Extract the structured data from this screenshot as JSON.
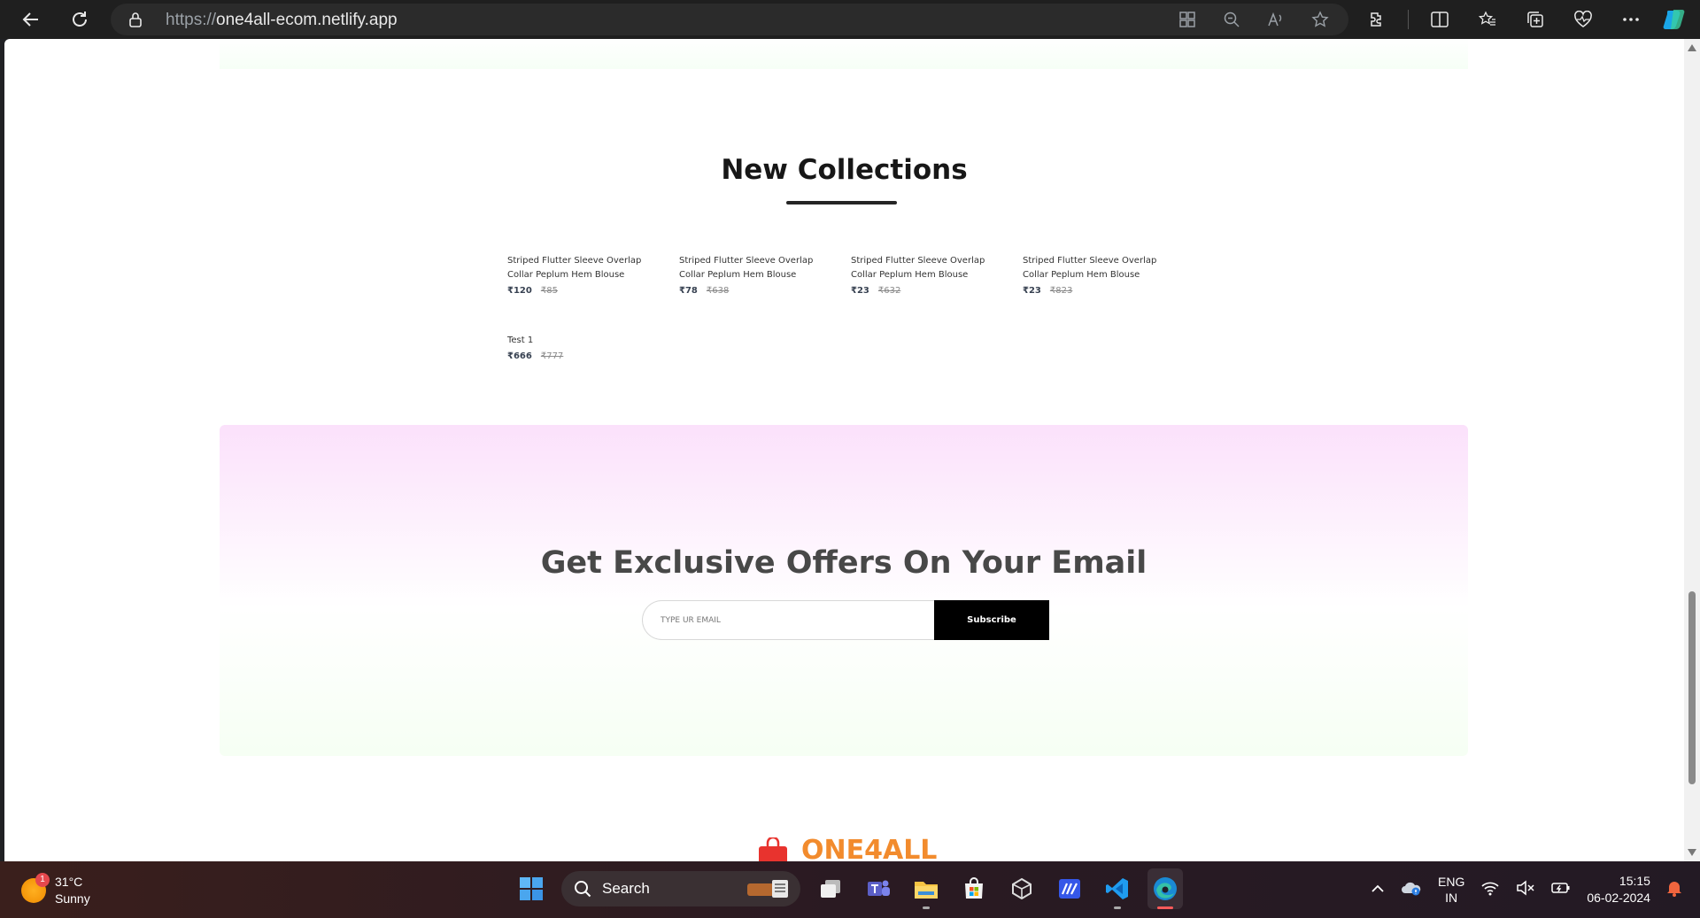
{
  "browser": {
    "url_prefix": "https://",
    "url_host": "one4all-ecom.netlify.app"
  },
  "section": {
    "title": "New Collections"
  },
  "products": [
    {
      "name": "Striped Flutter Sleeve Overlap Collar Peplum Hem Blouse",
      "new_price": "₹120",
      "old_price": "₹85"
    },
    {
      "name": "Striped Flutter Sleeve Overlap Collar Peplum Hem Blouse",
      "new_price": "₹78",
      "old_price": "₹638"
    },
    {
      "name": "Striped Flutter Sleeve Overlap Collar Peplum Hem Blouse",
      "new_price": "₹23",
      "old_price": "₹632"
    },
    {
      "name": "Striped Flutter Sleeve Overlap Collar Peplum Hem Blouse",
      "new_price": "₹23",
      "old_price": "₹823"
    },
    {
      "name": "Test 1",
      "new_price": "₹666",
      "old_price": "₹777"
    }
  ],
  "offers": {
    "title": "Get Exclusive Offers On Your Email",
    "email_placeholder": "TYPE UR EMAIL",
    "subscribe_label": "Subscribe"
  },
  "footer": {
    "logo_text": "ONE4ALL"
  },
  "taskbar": {
    "weather_temp": "31°C",
    "weather_desc": "Sunny",
    "weather_badge": "1",
    "search_label": "Search",
    "lang_line1": "ENG",
    "lang_line2": "IN",
    "time": "15:15",
    "date": "06-02-2024"
  },
  "colors": {
    "accent_logo": "#f28b2d",
    "subscribe_bg": "#000000",
    "offers_top": "#fbe1fb"
  }
}
